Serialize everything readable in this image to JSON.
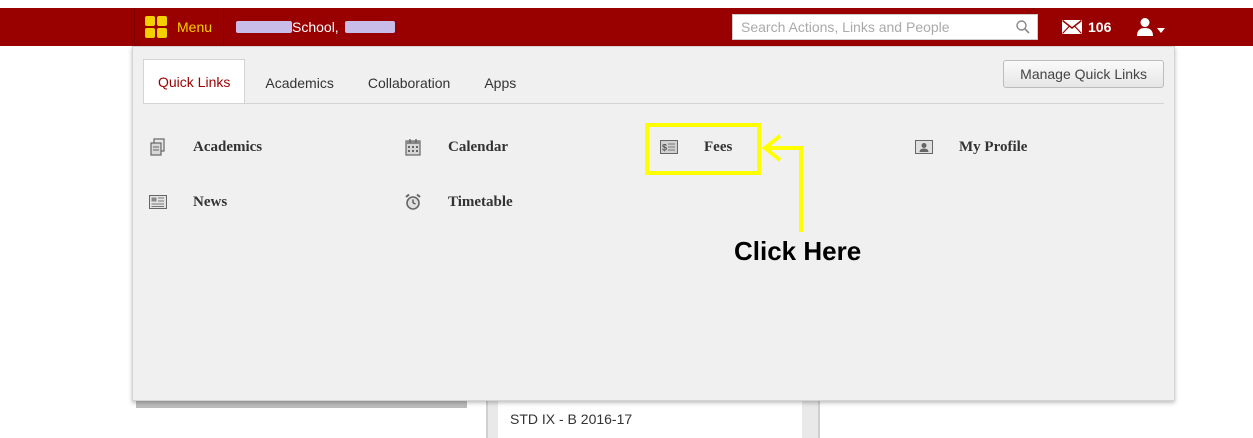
{
  "topbar": {
    "menu_label": "Menu",
    "school_name": "School,",
    "search_placeholder": "Search Actions, Links and People",
    "mail_count": "106"
  },
  "tabs": [
    {
      "label": "Quick Links",
      "active": true
    },
    {
      "label": "Academics",
      "active": false
    },
    {
      "label": "Collaboration",
      "active": false
    },
    {
      "label": "Apps",
      "active": false
    }
  ],
  "manage_label": "Manage Quick Links",
  "quick_links": [
    {
      "label": "Academics",
      "icon": "academics-icon"
    },
    {
      "label": "Calendar",
      "icon": "calendar-icon"
    },
    {
      "label": "Fees",
      "icon": "fees-icon"
    },
    {
      "label": "My Profile",
      "icon": "profile-icon"
    },
    {
      "label": "News",
      "icon": "news-icon"
    },
    {
      "label": "Timetable",
      "icon": "alarm-clock-icon"
    }
  ],
  "background_card": "STD IX - B 2016-17",
  "annotation": "Click Here",
  "colors": {
    "brand": "#990000",
    "menu_accent": "#f5d000",
    "highlight": "#ffff00"
  }
}
